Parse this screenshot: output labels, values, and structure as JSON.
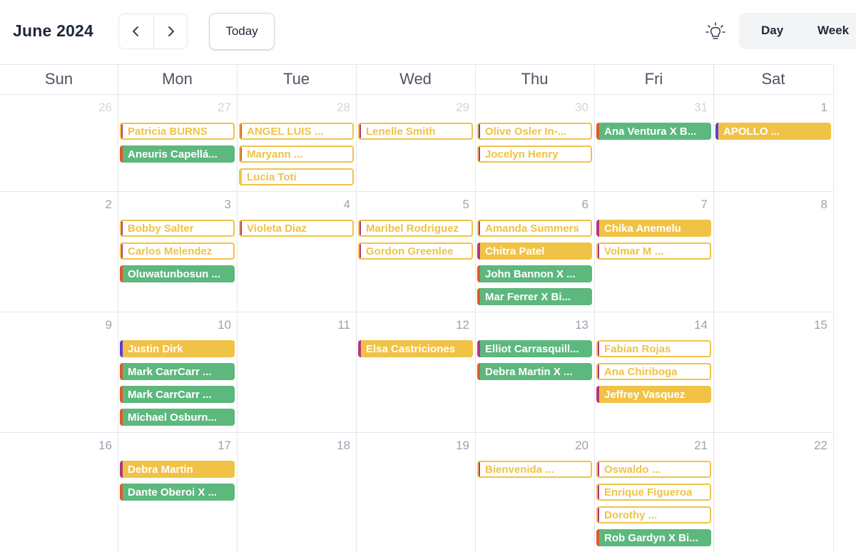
{
  "header": {
    "month_title": "June 2024",
    "today_label": "Today",
    "views": [
      "Day",
      "Week"
    ]
  },
  "colors": {
    "yellow": "#f0c246",
    "green": "#5cb87d",
    "accent_magenta": "#b5367e",
    "accent_orange": "#e05a2a",
    "accent_purple": "#5b3fd6"
  },
  "weekdays": [
    "Sun",
    "Mon",
    "Tue",
    "Wed",
    "Thu",
    "Fri",
    "Sat"
  ],
  "weeks": [
    {
      "dates": [
        "26",
        "27",
        "28",
        "29",
        "30",
        "31",
        "1"
      ],
      "muted": [
        true,
        true,
        true,
        true,
        true,
        true,
        false
      ],
      "events": [
        [],
        [
          {
            "label": "Patricia BURNS",
            "style": "outline",
            "accent": "magenta"
          },
          {
            "label": "Aneuris  Capellá...",
            "style": "green",
            "accent": "orange"
          }
        ],
        [
          {
            "label": "ANGEL LUIS ...",
            "style": "outline",
            "accent": "orange"
          },
          {
            "label": "Maryann    ...",
            "style": "outline",
            "accent": "orange"
          },
          {
            "label": "Lucia Toti",
            "style": "outline",
            "accent": "yellow"
          }
        ],
        [
          {
            "label": "Lenelle Smith",
            "style": "outline",
            "accent": "magenta"
          }
        ],
        [
          {
            "label": "Olive Osler In-...",
            "style": "outline",
            "accent": "purple"
          },
          {
            "label": "Jocelyn Henry",
            "style": "outline",
            "accent": "magenta"
          }
        ],
        [
          {
            "label": "Ana Ventura X B...",
            "style": "green",
            "accent": "orange"
          }
        ],
        [
          {
            "label": "APOLLO ...",
            "style": "yellow",
            "accent": "purple"
          }
        ]
      ]
    },
    {
      "dates": [
        "2",
        "3",
        "4",
        "5",
        "6",
        "7",
        "8"
      ],
      "muted": [
        false,
        false,
        false,
        false,
        false,
        false,
        false
      ],
      "events": [
        [],
        [
          {
            "label": "Bobby Salter",
            "style": "outline",
            "accent": "magenta"
          },
          {
            "label": "Carlos Melendez",
            "style": "outline",
            "accent": "magenta"
          },
          {
            "label": "Oluwatunbosun ...",
            "style": "green",
            "accent": "orange"
          }
        ],
        [
          {
            "label": "Violeta Diaz",
            "style": "outline",
            "accent": "magenta"
          }
        ],
        [
          {
            "label": "Maribel Rodriguez",
            "style": "outline",
            "accent": "magenta"
          },
          {
            "label": "Gordon Greenlee",
            "style": "outline",
            "accent": "magenta"
          }
        ],
        [
          {
            "label": "Amanda Summers",
            "style": "outline",
            "accent": "magenta"
          },
          {
            "label": "Chitra  Patel",
            "style": "yellow",
            "accent": "magenta"
          },
          {
            "label": "John Bannon X ...",
            "style": "green",
            "accent": "orange"
          },
          {
            "label": "Mar Ferrer  X Bi...",
            "style": "green",
            "accent": "orange"
          }
        ],
        [
          {
            "label": "Chika Anemelu",
            "style": "yellow",
            "accent": "magenta"
          },
          {
            "label": "Volmar M ...",
            "style": "outline",
            "accent": "magenta"
          }
        ],
        []
      ]
    },
    {
      "dates": [
        "9",
        "10",
        "11",
        "12",
        "13",
        "14",
        "15"
      ],
      "muted": [
        false,
        false,
        false,
        false,
        false,
        false,
        false
      ],
      "events": [
        [],
        [
          {
            "label": "Justin  Dirk",
            "style": "yellow",
            "accent": "purple"
          },
          {
            "label": "Mark CarrCarr ...",
            "style": "green",
            "accent": "orange"
          },
          {
            "label": "Mark CarrCarr ...",
            "style": "green",
            "accent": "orange"
          },
          {
            "label": "Michael  Osburn...",
            "style": "green",
            "accent": "orange"
          }
        ],
        [],
        [
          {
            "label": "Elsa  Castriciones",
            "style": "yellow",
            "accent": "magenta"
          }
        ],
        [
          {
            "label": "Elliot Carrasquill...",
            "style": "green",
            "accent": "magenta"
          },
          {
            "label": "Debra Martin X ...",
            "style": "green",
            "accent": "orange"
          }
        ],
        [
          {
            "label": "Fabian  Rojas",
            "style": "outline",
            "accent": "magenta"
          },
          {
            "label": "Ana Chiriboga",
            "style": "outline",
            "accent": "magenta"
          },
          {
            "label": "Jeffrey Vasquez",
            "style": "yellow",
            "accent": "magenta"
          }
        ],
        []
      ]
    },
    {
      "dates": [
        "16",
        "17",
        "18",
        "19",
        "20",
        "21",
        "22"
      ],
      "muted": [
        false,
        false,
        false,
        false,
        false,
        false,
        false
      ],
      "events": [
        [],
        [
          {
            "label": "Debra Martin",
            "style": "yellow",
            "accent": "magenta"
          },
          {
            "label": "Dante Oberoi X ...",
            "style": "green",
            "accent": "orange"
          }
        ],
        [],
        [],
        [
          {
            "label": "Bienvenida ...",
            "style": "outline",
            "accent": "magenta"
          }
        ],
        [
          {
            "label": "Oswaldo ...",
            "style": "outline",
            "accent": "magenta"
          },
          {
            "label": "Enrique  Figueroa",
            "style": "outline",
            "accent": "magenta"
          },
          {
            "label": "Dorothy  ...",
            "style": "outline",
            "accent": "magenta"
          },
          {
            "label": "Rob Gardyn X Bi...",
            "style": "green",
            "accent": "orange"
          }
        ],
        []
      ]
    }
  ]
}
